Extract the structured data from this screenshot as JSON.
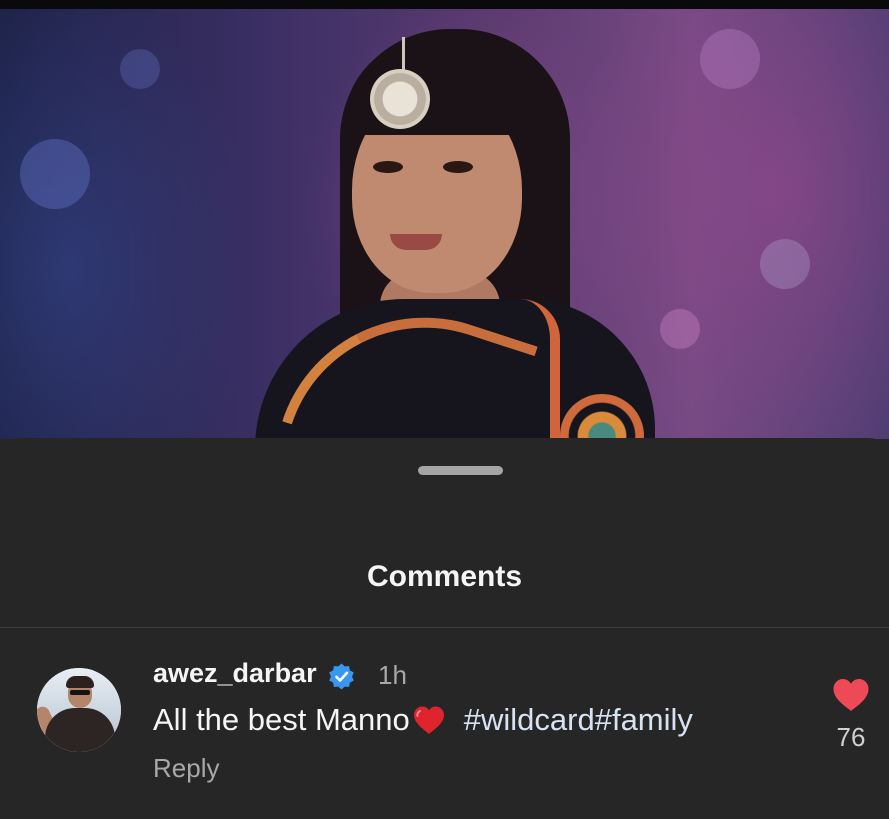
{
  "photo": {
    "description_icon": "post-photo"
  },
  "sheet": {
    "title": "Comments"
  },
  "comment": {
    "username": "awez_darbar",
    "verified_icon": "verified-badge-icon",
    "time": "1h",
    "text": "All the best Manno",
    "emoji": "❤️",
    "hashtags": "#wildcard#family",
    "reply_label": "Reply",
    "like_count": "76",
    "like_icon": "heart-icon"
  },
  "colors": {
    "background": "#262626",
    "like": "#ed4956",
    "verified": "#3897f0",
    "text_primary": "#f5f5f5",
    "text_secondary": "#a8a8a8"
  }
}
